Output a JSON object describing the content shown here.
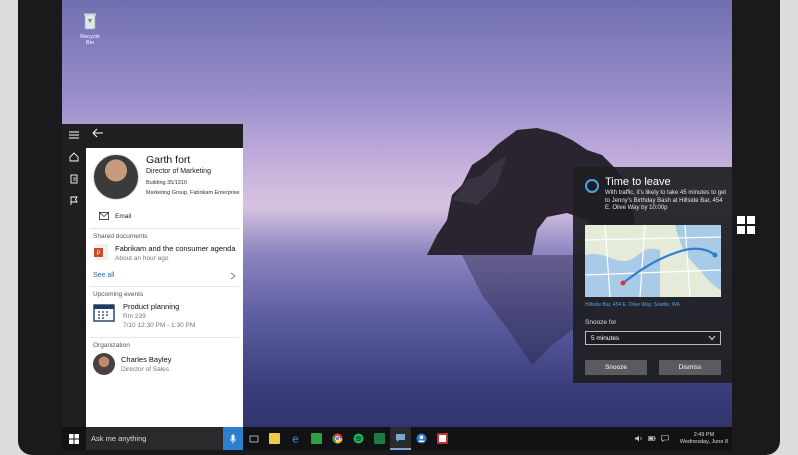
{
  "desktop": {
    "recycle_bin_label": "Recycle Bin"
  },
  "cortana": {
    "profile": {
      "name": "Garth fort",
      "title": "Director of Marketing",
      "building": "Building 35/1310",
      "group": "Marketing Group, Fabrikam Enterprise",
      "email_label": "Email"
    },
    "shared_documents": {
      "header": "Shared documents",
      "items": [
        {
          "title": "Fabrikam and the consumer agenda",
          "subtitle": "About an hour ago"
        }
      ],
      "see_all": "See all"
    },
    "upcoming_events": {
      "header": "Upcoming events",
      "items": [
        {
          "title": "Product planning",
          "room": "Rm 239",
          "time": "7/10 12:30 PM - 1:30 PM"
        }
      ]
    },
    "organization": {
      "header": "Organization",
      "items": [
        {
          "name": "Charles Bayley",
          "title": "Director of Sales"
        }
      ]
    }
  },
  "time_to_leave": {
    "title": "Time to leave",
    "description": "With traffic, it's likely to take 45 minutes to get to Jenny's Birthday Bash at Hillside Bar, 454 E. Olive Way by 10:00p",
    "map_caption": "Hillside Bar, 454 E. Olive Way, Seattle, WA",
    "snooze_label": "Snooze for",
    "snooze_value": "5 minutes",
    "snooze_button": "Snooze",
    "dismiss_button": "Dismiss"
  },
  "taskbar": {
    "search_placeholder": "Ask me anything",
    "clock_time": "2:49 PM",
    "clock_date": "Wednesday, June 8"
  },
  "colors": {
    "accent": "#2f7fd0",
    "link": "#2b6cc4",
    "ring": "#4aa3e6"
  }
}
